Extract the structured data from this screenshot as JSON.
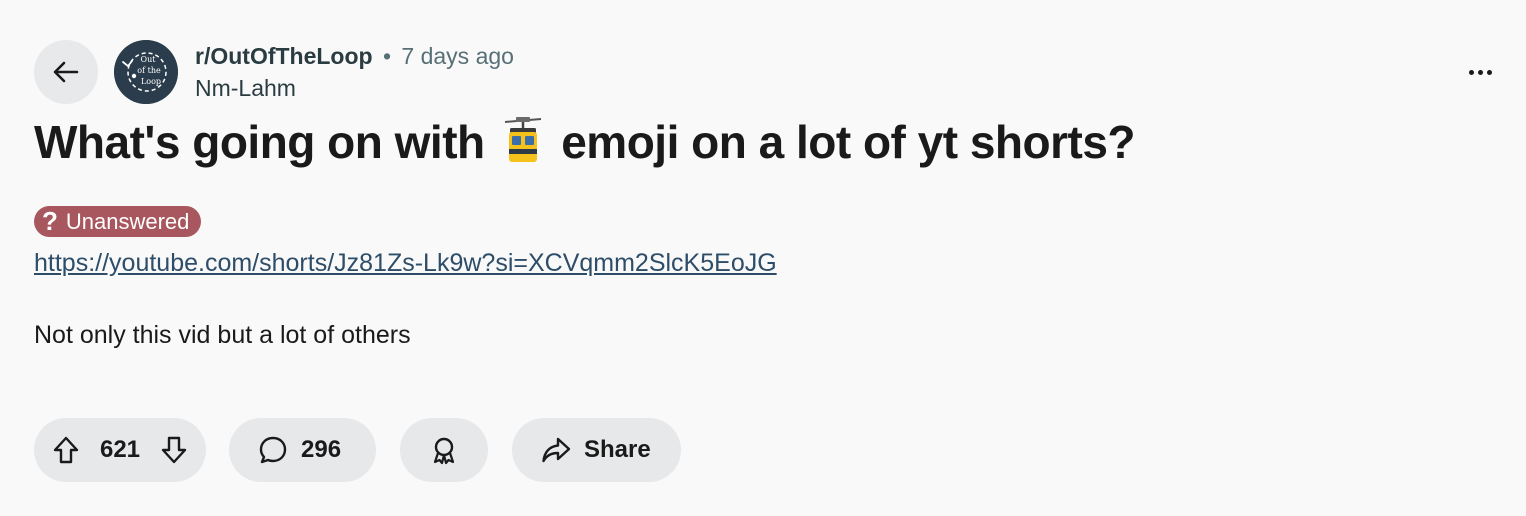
{
  "post": {
    "subreddit": "r/OutOfTheLoop",
    "separator": "•",
    "time_ago": "7 days ago",
    "author": "Nm-Lahm",
    "title_before": "What's going on with",
    "title_emoji": "aerial-tramway-emoji",
    "title_after": "emoji on a lot of yt shorts?",
    "flair_label": "Unanswered",
    "flair_icon": "?",
    "link": "https://youtube.com/shorts/Jz81Zs-Lk9w?si=XCVqmm2SlcK5EoJG",
    "body": "Not only this vid but a lot of others"
  },
  "avatar": {
    "line1": "Out",
    "line2": "of the",
    "line3": "Loop"
  },
  "actions": {
    "upvotes": "621",
    "comments": "296",
    "share_label": "Share"
  },
  "icons": {
    "back": "arrow-left-icon",
    "more": "more-options-icon",
    "upvote": "upvote-arrow-icon",
    "downvote": "downvote-arrow-icon",
    "comment": "comment-bubble-icon",
    "award": "award-icon",
    "share": "share-arrow-icon"
  },
  "colors": {
    "background": "#f9f9f9",
    "pill_bg": "#e6e8ea",
    "flair_bg": "#a8575e",
    "link": "#2d4d68",
    "avatar_bg": "#2b3d4c"
  }
}
